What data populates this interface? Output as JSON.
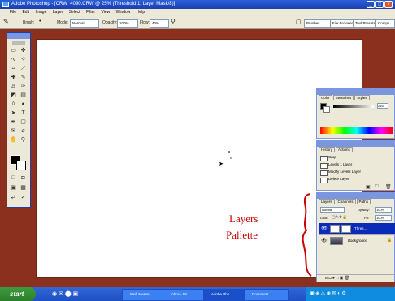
{
  "window": {
    "title": "Adobe Photoshop - [CRW_4090.CRW @ 25% (Threshold 1, Layer Mask/8)]"
  },
  "menu": [
    "File",
    "Edit",
    "Image",
    "Layer",
    "Select",
    "Filter",
    "View",
    "Window",
    "Help"
  ],
  "options_bar": {
    "brush_label": "Brush:",
    "mode_label": "Mode:",
    "mode_value": "Normal",
    "opacity_label": "Opacity:",
    "opacity_value": "100%",
    "flow_label": "Flow:",
    "flow_value": "40%",
    "palette_tabs": [
      "Brushes",
      "File Browser",
      "Tool Presets",
      "Comps"
    ]
  },
  "color_panel": {
    "tabs": [
      "Color",
      "Swatches",
      "Styles"
    ],
    "slider_value": "255"
  },
  "history_panel": {
    "tabs": [
      "History",
      "Actions"
    ],
    "items": [
      "Crop",
      "Levels 1 Layer",
      "Modify Levels Layer",
      "Delete Layer"
    ]
  },
  "layers_panel": {
    "tabs": [
      "Layers",
      "Channels",
      "Paths"
    ],
    "blend_mode": "Normal",
    "opacity_label": "Opacity:",
    "opacity_value": "100%",
    "lock_label": "Lock:",
    "fill_label": "Fill:",
    "fill_value": "100%",
    "layers": [
      {
        "name": "Thres...",
        "selected": true
      },
      {
        "name": "Background",
        "selected": false
      }
    ]
  },
  "annotation": {
    "line1": "Layers",
    "line2": "Pallette",
    "color": "#cc0000"
  },
  "taskbar": {
    "start_label": "start",
    "tasks": [
      "Web Messe...",
      "Inbox - Mi...",
      "Adobe Pho...",
      "Document..."
    ]
  },
  "colors": {
    "workspace": "#8b2f1e",
    "titlebar": "#1a3fb0",
    "selected_layer": "#0a2bb8"
  }
}
